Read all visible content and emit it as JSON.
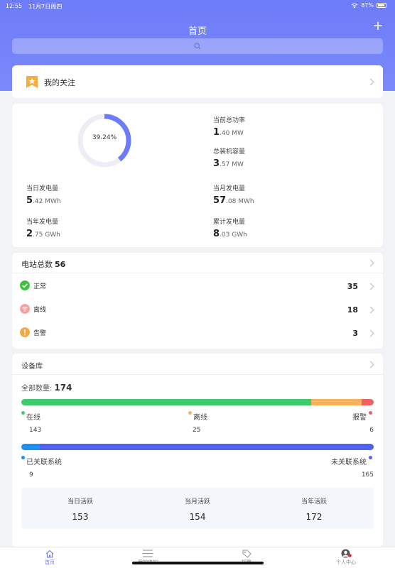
{
  "status_bar": {
    "time": "12:55",
    "date": "11月7日周四",
    "battery": "87%"
  },
  "nav": {
    "title": "首页",
    "plus": "+"
  },
  "favorites": {
    "label": "我的关注"
  },
  "power": {
    "ratio_text": "39.24%",
    "ratio": 0.3924,
    "stats": [
      {
        "title": "当前总功率",
        "big": "1",
        "rest": ".40 MW"
      },
      {
        "title": "总装机容量",
        "big": "3",
        "rest": ".57 MW"
      },
      {
        "title": "当日发电量",
        "big": "5",
        "rest": ".42 MWh"
      },
      {
        "title": "当月发电量",
        "big": "57",
        "rest": ".08 MWh"
      },
      {
        "title": "当年发电量",
        "big": "2",
        "rest": ".75 GWh"
      },
      {
        "title": "累计发电量",
        "big": "8",
        "rest": ".03 GWh"
      }
    ]
  },
  "station": {
    "title": "电站总数",
    "count": "56",
    "rows": [
      {
        "label": "正常",
        "value": "35",
        "color": "#3bc43b"
      },
      {
        "label": "离线",
        "value": "18",
        "color": "#f4a1a1"
      },
      {
        "label": "告警",
        "value": "3",
        "color": "#f4a742"
      }
    ]
  },
  "device": {
    "title": "设备库",
    "total_label": "全部数量:",
    "total": "174",
    "status": [
      {
        "label": "在线",
        "value": "143",
        "count": 143,
        "color": "#3dcb6b"
      },
      {
        "label": "离线",
        "value": "25",
        "count": 25,
        "color": "#f6b35c"
      },
      {
        "label": "报警",
        "value": "6",
        "count": 6,
        "color": "#f06262"
      }
    ],
    "relation": [
      {
        "label": "已关联系统",
        "value": "9",
        "count": 9,
        "color": "#1e90f0"
      },
      {
        "label": "未关联系统",
        "value": "165",
        "count": 165,
        "color": "#5162f0"
      }
    ],
    "activity": [
      {
        "label": "当日活跃",
        "value": "153"
      },
      {
        "label": "当月活跃",
        "value": "154"
      },
      {
        "label": "当年活跃",
        "value": "172"
      }
    ]
  },
  "tabs": [
    {
      "label": "首页",
      "active": true
    },
    {
      "label": "我的电站",
      "active": false
    },
    {
      "label": "报警",
      "active": false
    },
    {
      "label": "个人中心",
      "active": false
    }
  ],
  "colors": {
    "accent": "#6d7cf8",
    "donut_track": "#ecedf5",
    "donut_fill": "#6d7cf8",
    "tab_active": "#6d7cf8"
  }
}
